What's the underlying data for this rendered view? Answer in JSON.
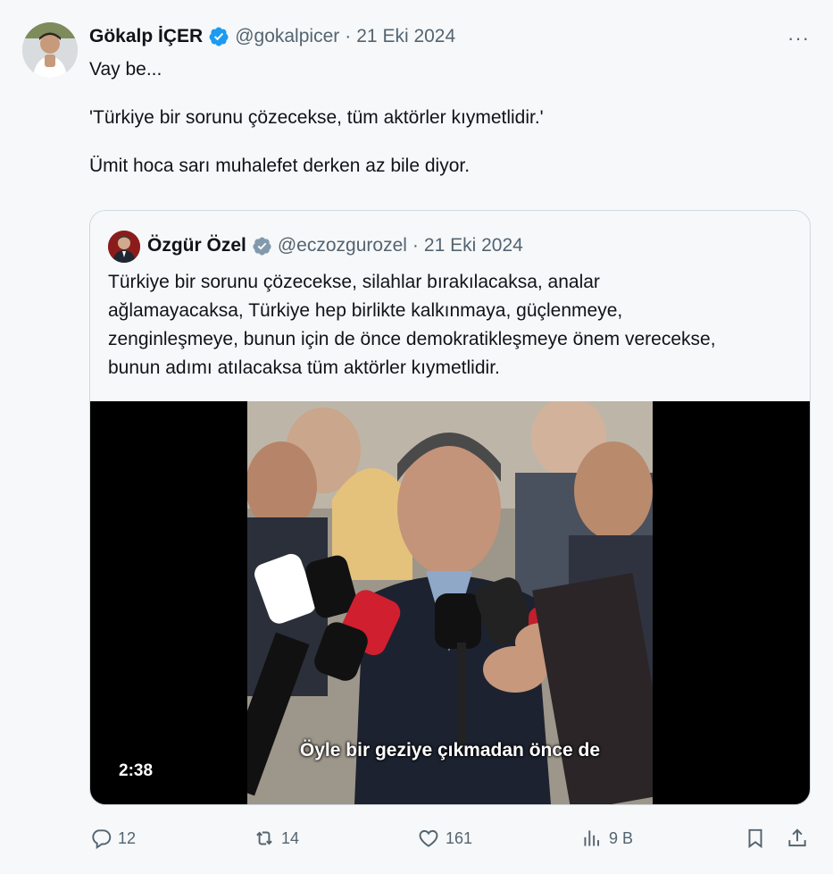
{
  "tweet": {
    "author_name": "Gökalp İÇER",
    "author_handle": "@gokalpicer",
    "separator": "·",
    "date": "21 Eki 2024",
    "more": "···",
    "text_lines": [
      "Vay be...",
      "'Türkiye bir sorunu çözecekse, tüm aktörler kıymetlidir.'",
      "Ümit hoca sarı muhalefet derken az bile diyor."
    ]
  },
  "quote": {
    "author_name": "Özgür Özel",
    "author_handle": "@eczozgurozel",
    "separator": "·",
    "date": "21 Eki 2024",
    "text": "Türkiye bir sorunu çözecekse, silahlar bırakılacaksa, analar ağlamayacaksa, Türkiye hep birlikte kalkınmaya, güçlenmeye, zenginleşmeye, bunun için de önce  demokratikleşmeye önem verecekse, bunun adımı atılacaksa tüm aktörler kıymetlidir.",
    "video": {
      "subtitle": "Öyle bir geziye çıkmadan önce de",
      "duration": "2:38"
    }
  },
  "actions": {
    "replies": "12",
    "reposts": "14",
    "likes": "161",
    "views": "9 B"
  },
  "colors": {
    "verified": "#1d9bf0",
    "quote_verified": "#829aab",
    "muted": "#536471"
  },
  "icons": [
    "verified-badge-icon",
    "reply-icon",
    "repost-icon",
    "like-icon",
    "views-icon",
    "bookmark-icon",
    "share-icon",
    "more-icon"
  ]
}
